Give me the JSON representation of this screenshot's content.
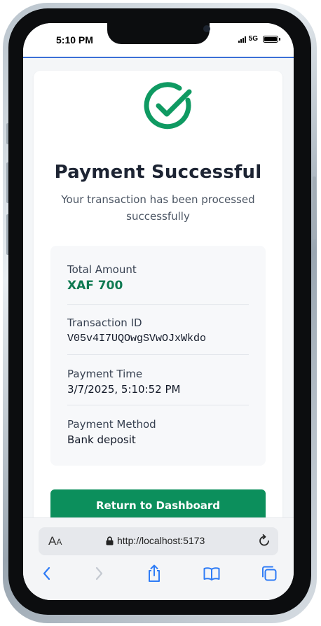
{
  "status_bar": {
    "time": "5:10 PM",
    "network": "5G"
  },
  "receipt": {
    "title": "Payment Successful",
    "subtitle": "Your transaction has been processed successfully",
    "details": [
      {
        "label": "Total Amount",
        "value": "XAF 700"
      },
      {
        "label": "Transaction ID",
        "value": "V05v4I7UQOwgSVwOJxWkdo"
      },
      {
        "label": "Payment Time",
        "value": "3/7/2025, 5:10:52 PM"
      },
      {
        "label": "Payment Method",
        "value": "Bank deposit"
      }
    ],
    "return_button_label": "Return to Dashboard"
  },
  "browser": {
    "text_size_label": "AA",
    "url": "http://localhost:5173",
    "toolbar_icons": [
      "back-icon",
      "forward-icon",
      "share-icon",
      "bookmarks-icon",
      "tabs-icon"
    ]
  },
  "colors": {
    "success_green": "#0f7a52",
    "button_green": "#0c8f5c",
    "ios_blue": "#2f7cf6",
    "accent_line": "#3b6fd6"
  }
}
